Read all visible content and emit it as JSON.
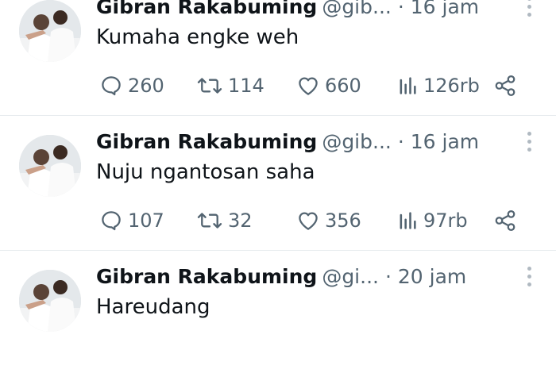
{
  "tweets": [
    {
      "name": "Gibran Rakabuming",
      "handle": "@gib...",
      "time": "· 16 jam",
      "text": "Kumaha engke weh",
      "replies": "260",
      "retweets": "114",
      "likes": "660",
      "views": "126rb"
    },
    {
      "name": "Gibran Rakabuming",
      "handle": "@gib...",
      "time": "· 16 jam",
      "text": "Nuju ngantosan saha",
      "replies": "107",
      "retweets": "32",
      "likes": "356",
      "views": "97rb"
    },
    {
      "name": "Gibran Rakabuming",
      "handle": "@gi...",
      "time": "· 20 jam",
      "text": "Hareudang",
      "replies": "",
      "retweets": "",
      "likes": "",
      "views": ""
    }
  ],
  "icons": {
    "reply": "reply-icon",
    "retweet": "retweet-icon",
    "like": "heart-icon",
    "views": "views-icon",
    "share": "share-icon",
    "more": "more-icon"
  },
  "colors": {
    "text": "#0f1419",
    "secondary": "#536471",
    "divider": "#e7ebee"
  }
}
